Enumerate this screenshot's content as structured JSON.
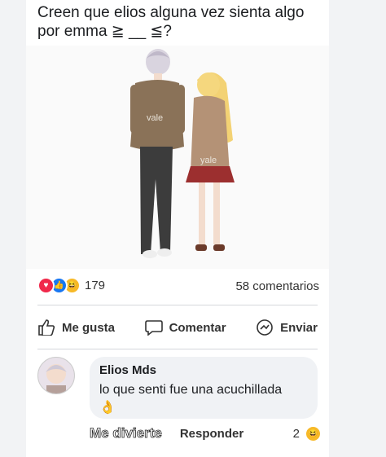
{
  "post": {
    "text": "Creen que elios alguna vez sienta algo por emma ≧ __ ≦?",
    "image_labels": [
      "vale",
      "yale"
    ]
  },
  "reactions": {
    "icons": [
      "love-icon",
      "like-icon",
      "haha-icon"
    ],
    "count": "179",
    "comments": "58 comentarios"
  },
  "actions": {
    "like": "Me gusta",
    "comment": "Comentar",
    "share": "Enviar"
  },
  "comment": {
    "author": "Elios Mds",
    "text": "lo que senti fue una acuchillada",
    "emoji": "👌",
    "reaction_label": "Me divierte",
    "reply_label": "Responder",
    "reaction_count": "2"
  },
  "colors": {
    "like": "#1877f2",
    "love": "#f0284a",
    "haha": "#f7b928"
  }
}
